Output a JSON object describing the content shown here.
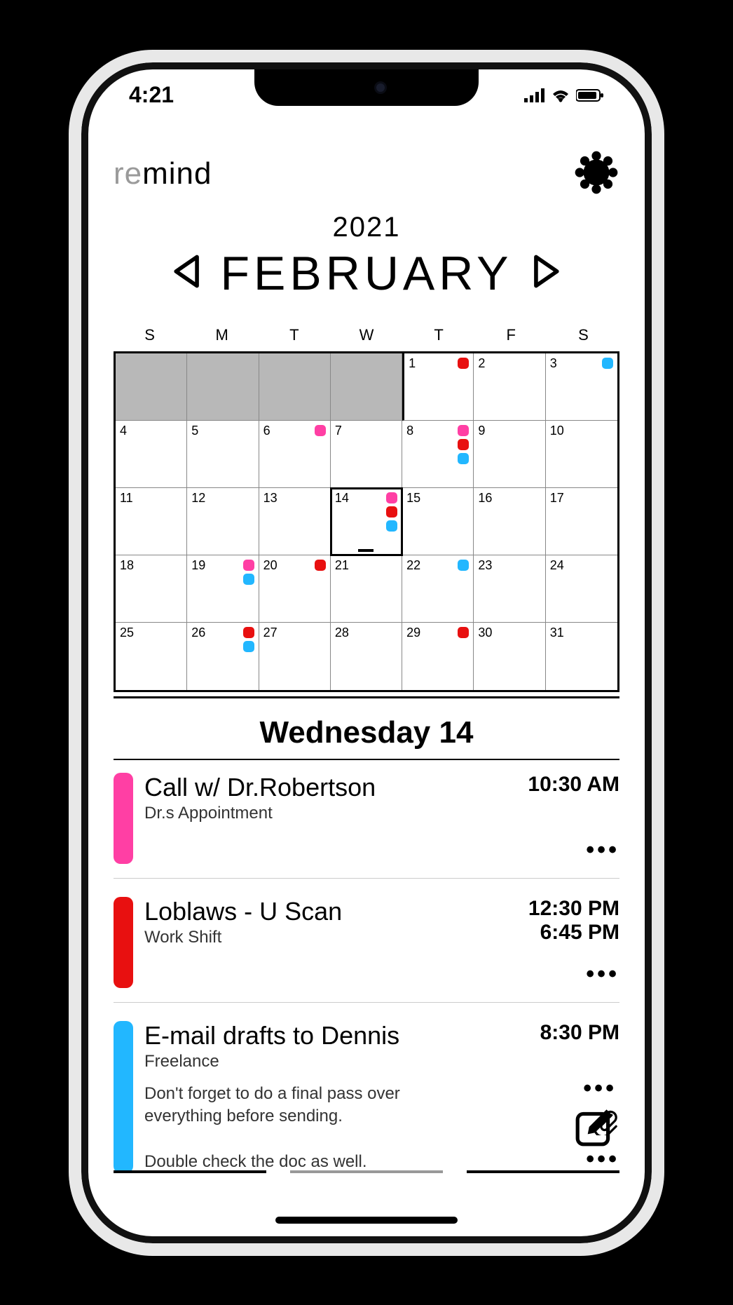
{
  "status": {
    "time": "4:21"
  },
  "app": {
    "name_pre": "re",
    "name_post": "mind"
  },
  "calendar": {
    "year": "2021",
    "month": "FEBRUARY",
    "dow": [
      "S",
      "M",
      "T",
      "W",
      "T",
      "F",
      "S"
    ],
    "colors": {
      "pink": "#ff3fa4",
      "red": "#e81010",
      "blue": "#22b7ff"
    },
    "selected_day": 14,
    "grid_start_blank": 4,
    "days": [
      {
        "n": 1,
        "dots": [
          "red"
        ]
      },
      {
        "n": 2,
        "dots": []
      },
      {
        "n": 3,
        "dots": [
          "blue"
        ]
      },
      {
        "n": 4,
        "dots": []
      },
      {
        "n": 5,
        "dots": []
      },
      {
        "n": 6,
        "dots": [
          "pink"
        ]
      },
      {
        "n": 7,
        "dots": []
      },
      {
        "n": 8,
        "dots": [
          "pink",
          "red",
          "blue"
        ]
      },
      {
        "n": 9,
        "dots": []
      },
      {
        "n": 10,
        "dots": []
      },
      {
        "n": 11,
        "dots": []
      },
      {
        "n": 12,
        "dots": []
      },
      {
        "n": 13,
        "dots": []
      },
      {
        "n": 14,
        "dots": [
          "pink",
          "red",
          "blue"
        ],
        "selected": true
      },
      {
        "n": 15,
        "dots": []
      },
      {
        "n": 16,
        "dots": []
      },
      {
        "n": 17,
        "dots": []
      },
      {
        "n": 18,
        "dots": []
      },
      {
        "n": 19,
        "dots": [
          "pink",
          "blue"
        ]
      },
      {
        "n": 20,
        "dots": [
          "red"
        ]
      },
      {
        "n": 21,
        "dots": []
      },
      {
        "n": 22,
        "dots": [
          "blue"
        ]
      },
      {
        "n": 23,
        "dots": []
      },
      {
        "n": 24,
        "dots": []
      },
      {
        "n": 25,
        "dots": []
      },
      {
        "n": 26,
        "dots": [
          "red",
          "blue"
        ]
      },
      {
        "n": 27,
        "dots": []
      },
      {
        "n": 28,
        "dots": []
      },
      {
        "n": 29,
        "dots": [
          "red"
        ]
      },
      {
        "n": 30,
        "dots": []
      },
      {
        "n": 31,
        "dots": []
      }
    ]
  },
  "day_header": "Wednesday 14",
  "events": [
    {
      "color": "pink",
      "title": "Call w/ Dr.Robertson",
      "category": "Dr.s Appointment",
      "times": [
        "10:30 AM"
      ],
      "note": "",
      "attachment": false
    },
    {
      "color": "red",
      "title": "Loblaws - U Scan",
      "category": "Work Shift",
      "times": [
        "12:30 PM",
        "6:45 PM"
      ],
      "note": "",
      "attachment": false
    },
    {
      "color": "blue",
      "title": "E-mail drafts to Dennis",
      "category": "Freelance",
      "times": [
        "8:30 PM"
      ],
      "note": "Don't forget to do a final pass over everything before sending.\n\nDouble check the doc as well.",
      "attachment": true
    }
  ]
}
